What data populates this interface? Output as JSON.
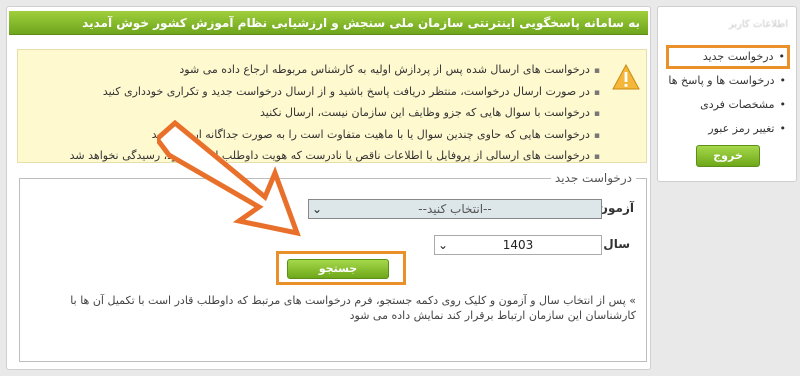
{
  "header": {
    "title": "به سامانه پاسخگویی اینترنتی سازمان ملی سنجش و ارزشیابی نظام آموزش کشور خوش آمدید"
  },
  "notice": {
    "icon": "warning-icon",
    "items": [
      "درخواست های ارسال شده پس از پردازش اولیه به کارشناس مربوطه ارجاع داده می شود",
      "در صورت ارسال درخواست، منتظر دریافت پاسخ باشید و از ارسال درخواست جدید و تکراری خودداری کنید",
      "درخواست با سوال هایی که جزو وظایف این سازمان نیست، ارسال نکنید",
      "درخواست هایی که حاوی چندین سوال یا با ماهیت متفاوت است را به صورت جداگانه ارسال کنید",
      "درخواست های ارسالی از پروفایل با اطلاعات ناقص یا نادرست که هویت داوطلب احراز نشود، رسیدگی نخواهد شد"
    ]
  },
  "form": {
    "legend": "درخواست جدید",
    "exam_label": "آزمون",
    "exam_value": "--انتخاب کنید--",
    "year_label": "سال",
    "year_value": "1403",
    "search_button": "جستجو",
    "hint": "» پس از انتخاب سال و آزمون و کلیک روی دکمه جستجو، فرم درخواست های مرتبط که داوطلب قادر است با تکمیل آن ها با کارشناسان این سازمان ارتباط برقرار کند نمایش داده می شود"
  },
  "sidebar": {
    "user_name": "اطلاعات کاربر",
    "items": [
      {
        "label": "درخواست جدید",
        "active": true
      },
      {
        "label": "درخواست ها و پاسخ ها",
        "active": false
      },
      {
        "label": "مشخصات فردی",
        "active": false
      },
      {
        "label": "تغییر رمز عبور",
        "active": false
      }
    ],
    "logout_button": "خروج"
  },
  "colors": {
    "header_green": "#7fb52a",
    "highlight_orange": "#e9902a",
    "notice_bg": "#fff9cf",
    "select_bg": "#dde7ea"
  }
}
